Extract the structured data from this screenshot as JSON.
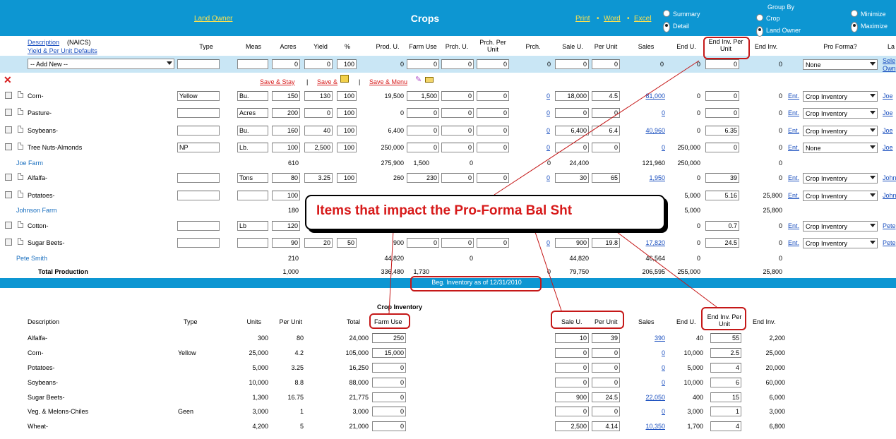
{
  "header": {
    "land_owner": "Land Owner",
    "title": "Crops",
    "print": "Print",
    "word": "Word",
    "excel": "Excel",
    "sep": "•",
    "view_summary": "Summary",
    "view_detail": "Detail",
    "group_by": "Group By",
    "group_crop": "Crop",
    "group_land_owner": "Land Owner",
    "minimize": "Minimize",
    "maximize": "Maximize"
  },
  "columns": {
    "description": "Description",
    "naics": "(NAICS)",
    "yield_defaults": "Yield & Per Unit Defaults",
    "type": "Type",
    "meas": "Meas",
    "acres": "Acres",
    "yield": "Yield",
    "pct": "%",
    "prod_u": "Prod. U.",
    "farm_use": "Farm Use",
    "prch_u": "Prch. U.",
    "prch_per_unit": "Prch. Per Unit",
    "prch": "Prch.",
    "sale_u": "Sale U.",
    "per_unit": "Per Unit",
    "sales": "Sales",
    "end_u": "End U.",
    "end_inv_per_unit": "End Inv. Per Unit",
    "end_inv": "End Inv.",
    "pro_forma": "Pro Forma?",
    "la": "La"
  },
  "add_row": {
    "select": "-- Add New --",
    "acres": "0",
    "yield": "0",
    "pct": "100",
    "prod_u": "0",
    "farm_use": "0",
    "prch_u": "0",
    "prch_per_unit": "0",
    "prch": "0",
    "sale_u": "0",
    "per_unit": "0",
    "sales": "0",
    "end_u": "0",
    "end_inv_per_unit": "0",
    "end_inv": "0",
    "pro_forma": "None",
    "link1": "Sele",
    "link2": "Own"
  },
  "actions": {
    "save_stay": "Save & Stay",
    "save_and": "Save &",
    "save_menu": "Save & Menu",
    "bar": "|"
  },
  "rows": [
    {
      "desc": "Corn-",
      "type": "Yellow",
      "meas": "Bu.",
      "acres": "150",
      "yield": "130",
      "pct": "100",
      "prod_u": "19,500",
      "farm_use": "1,500",
      "prch_u": "0",
      "prch_pu": "0",
      "prch": "0",
      "sale_u": "18,000",
      "per_unit": "4.5",
      "sales": "81,000",
      "end_u": "0",
      "end_inv_pu": "0",
      "end_inv": "0",
      "ent": "Ent.",
      "pro_forma": "Crop Inventory",
      "owner": "Joe"
    },
    {
      "desc": "Pasture-",
      "type": "",
      "meas": "Acres",
      "acres": "200",
      "yield": "0",
      "pct": "100",
      "prod_u": "0",
      "farm_use": "0",
      "prch_u": "0",
      "prch_pu": "0",
      "prch": "0",
      "sale_u": "0",
      "per_unit": "0",
      "sales": "0",
      "end_u": "0",
      "end_inv_pu": "0",
      "end_inv": "0",
      "ent": "Ent.",
      "pro_forma": "Crop Inventory",
      "owner": "Joe"
    },
    {
      "desc": "Soybeans-",
      "type": "",
      "meas": "Bu.",
      "acres": "160",
      "yield": "40",
      "pct": "100",
      "prod_u": "6,400",
      "farm_use": "0",
      "prch_u": "0",
      "prch_pu": "0",
      "prch": "0",
      "sale_u": "6,400",
      "per_unit": "6.4",
      "sales": "40,960",
      "end_u": "0",
      "end_inv_pu": "6.35",
      "end_inv": "0",
      "ent": "Ent.",
      "pro_forma": "Crop Inventory",
      "owner": "Joe"
    },
    {
      "desc": "Tree Nuts-Almonds",
      "type": "NP",
      "meas": "Lb.",
      "acres": "100",
      "yield": "2,500",
      "pct": "100",
      "prod_u": "250,000",
      "farm_use": "0",
      "prch_u": "0",
      "prch_pu": "0",
      "prch": "0",
      "sale_u": "0",
      "per_unit": "0",
      "sales": "0",
      "end_u": "250,000",
      "end_inv_pu": "0",
      "end_inv": "0",
      "ent": "Ent.",
      "pro_forma": "None",
      "owner": "Joe"
    }
  ],
  "subtotal_joe": {
    "name": "Joe Farm",
    "acres": "610",
    "prod_u": "275,900",
    "farm_use": "1,500",
    "prch_u": "0",
    "prch": "0",
    "sale_u": "24,400",
    "sales": "121,960",
    "end_u": "250,000",
    "end_inv": "0"
  },
  "rows2": [
    {
      "desc": "Alfalfa-",
      "meas": "Tons",
      "acres": "80",
      "yield": "3.25",
      "pct": "100",
      "prod_u": "260",
      "farm_use": "230",
      "prch_u": "0",
      "prch_pu": "0",
      "prch": "0",
      "sale_u": "30",
      "per_unit": "65",
      "sales": "1,950",
      "end_u": "0",
      "end_inv_pu": "39",
      "end_inv": "0",
      "ent": "Ent.",
      "pro_forma": "Crop Inventory",
      "owner": "John"
    },
    {
      "desc": "Potatoes-",
      "meas": "",
      "acres": "100",
      "end_u": "5,000",
      "end_inv_pu": "5.16",
      "end_inv": "25,800",
      "ent": "Ent.",
      "pro_forma": "Crop Inventory",
      "owner": "John"
    }
  ],
  "subtotal_johnson": {
    "name": "Johnson Farm",
    "acres": "180",
    "end_u": "5,000",
    "end_inv": "25,800"
  },
  "rows3": [
    {
      "desc": "Cotton-",
      "meas": "Lb",
      "acres": "120",
      "end_u": "0",
      "end_inv_pu": "0.7",
      "end_inv": "0",
      "ent": "Ent.",
      "pro_forma": "Crop Inventory",
      "owner": "Pete"
    },
    {
      "desc": "Sugar Beets-",
      "meas": "",
      "acres": "90",
      "yield": "20",
      "pct": "50",
      "prod_u": "900",
      "farm_use": "0",
      "prch_u": "0",
      "prch_pu": "0",
      "prch": "0",
      "sale_u": "900",
      "per_unit": "19.8",
      "sales": "17,820",
      "end_u": "0",
      "end_inv_pu": "24.5",
      "end_inv": "0",
      "ent": "Ent.",
      "pro_forma": "Crop Inventory",
      "owner": "Pete"
    }
  ],
  "subtotal_pete": {
    "name": "Pete Smith",
    "acres": "210",
    "prod_u": "44,820",
    "prch_u": "0",
    "sale_u": "44,820",
    "sales": "46,564",
    "end_u": "0",
    "end_inv": "0"
  },
  "total": {
    "label": "Total Production",
    "acres": "1,000",
    "prod_u": "336,480",
    "farm_use": "1,730",
    "prch_u": "0",
    "sale_u": "79,750",
    "sales": "206,595",
    "end_u": "255,000",
    "end_inv": "25,800"
  },
  "callout": "Items that impact the Pro-Forma Bal Sht",
  "beg_inventory": {
    "banner": "Beg. Inventory as of 12/31/2010",
    "crop_inventory": "Crop Inventory",
    "headers": {
      "description": "Description",
      "type": "Type",
      "units": "Units",
      "per_unit": "Per Unit",
      "total": "Total",
      "farm_use": "Farm Use",
      "sale_u": "Sale U.",
      "per_unit2": "Per Unit",
      "sales": "Sales",
      "end_u": "End U.",
      "end_inv_pu": "End Inv. Per Unit",
      "end_inv": "End Inv."
    },
    "rows": [
      {
        "desc": "Alfalfa-",
        "type": "",
        "units": "300",
        "per_unit": "80",
        "total": "24,000",
        "farm_use": "250",
        "sale_u": "10",
        "per_unit2": "39",
        "sales": "390",
        "end_u": "40",
        "end_inv_pu": "55",
        "end_inv": "2,200"
      },
      {
        "desc": "Corn-",
        "type": "Yellow",
        "units": "25,000",
        "per_unit": "4.2",
        "total": "105,000",
        "farm_use": "15,000",
        "sale_u": "0",
        "per_unit2": "0",
        "sales": "0",
        "end_u": "10,000",
        "end_inv_pu": "2.5",
        "end_inv": "25,000"
      },
      {
        "desc": "Potatoes-",
        "type": "",
        "units": "5,000",
        "per_unit": "3.25",
        "total": "16,250",
        "farm_use": "0",
        "sale_u": "0",
        "per_unit2": "0",
        "sales": "0",
        "end_u": "5,000",
        "end_inv_pu": "4",
        "end_inv": "20,000"
      },
      {
        "desc": "Soybeans-",
        "type": "",
        "units": "10,000",
        "per_unit": "8.8",
        "total": "88,000",
        "farm_use": "0",
        "sale_u": "0",
        "per_unit2": "0",
        "sales": "0",
        "end_u": "10,000",
        "end_inv_pu": "6",
        "end_inv": "60,000"
      },
      {
        "desc": "Sugar Beets-",
        "type": "",
        "units": "1,300",
        "per_unit": "16.75",
        "total": "21,775",
        "farm_use": "0",
        "sale_u": "900",
        "per_unit2": "24.5",
        "sales": "22,050",
        "end_u": "400",
        "end_inv_pu": "15",
        "end_inv": "6,000"
      },
      {
        "desc": "Veg. & Melons-Chiles",
        "type": "Geen",
        "units": "3,000",
        "per_unit": "1",
        "total": "3,000",
        "farm_use": "0",
        "sale_u": "0",
        "per_unit2": "0",
        "sales": "0",
        "end_u": "3,000",
        "end_inv_pu": "1",
        "end_inv": "3,000"
      },
      {
        "desc": "Wheat-",
        "type": "",
        "units": "4,200",
        "per_unit": "5",
        "total": "21,000",
        "farm_use": "0",
        "sale_u": "2,500",
        "per_unit2": "4.14",
        "sales": "10,350",
        "end_u": "1,700",
        "end_inv_pu": "4",
        "end_inv": "6,800"
      }
    ]
  },
  "colors": {
    "topbar": "#0d96d2",
    "link_yellow": "#ffe34d",
    "annotation_red": "#c51818",
    "add_row_bg": "#c9e6f5"
  }
}
